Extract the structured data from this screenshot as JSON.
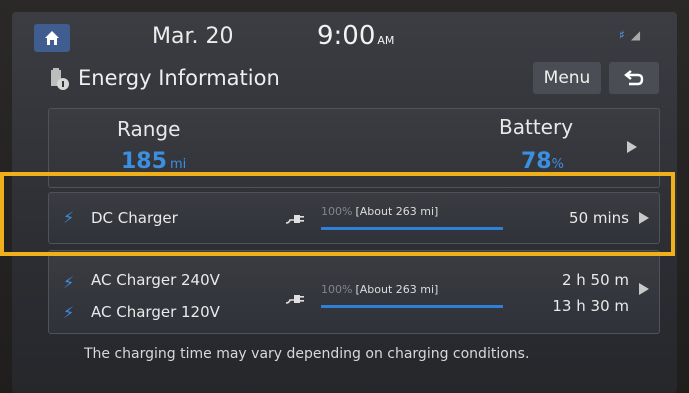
{
  "status": {
    "date": "Mar. 20",
    "time": "9:00",
    "ampm": "AM"
  },
  "header": {
    "title": "Energy Information",
    "menu_label": "Menu"
  },
  "summary": {
    "range_label": "Range",
    "range_value": "185",
    "range_unit": "mi",
    "battery_label": "Battery",
    "battery_value": "78",
    "battery_unit": "%"
  },
  "chargers": {
    "dc": {
      "label": "DC Charger",
      "percent": "100%",
      "about": "[About 263 mi]",
      "progress": 1.0,
      "time": "50 mins"
    },
    "ac": {
      "label_240": "AC Charger 240V",
      "label_120": "AC Charger 120V",
      "percent": "100%",
      "about": "[About 263 mi]",
      "progress": 1.0,
      "time_240": "2 h  50 m",
      "time_120": "13 h  30 m"
    }
  },
  "notice": "The charging time may vary depending on charging conditions.",
  "colors": {
    "accent": "#3b8fe0",
    "highlight": "#f0b01c"
  }
}
